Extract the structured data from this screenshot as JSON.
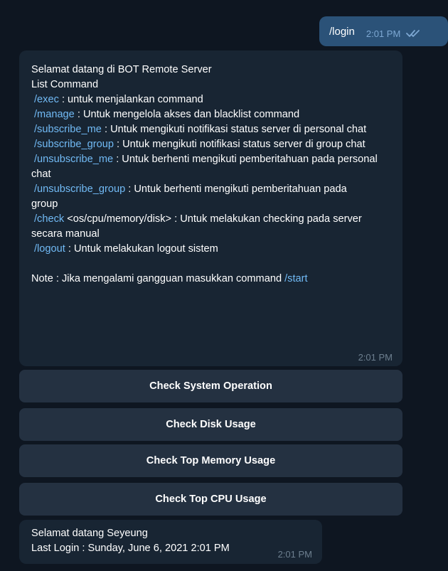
{
  "outgoing": {
    "text": "/login",
    "time": "2:01 PM",
    "status_icon": "double-check-icon"
  },
  "welcome_message": {
    "greeting": "Selamat datang di BOT Remote Server",
    "list_title": "List Command",
    "commands": [
      {
        "cmd": "/exec",
        "desc": " : untuk menjalankan command"
      },
      {
        "cmd": "/manage",
        "desc": " : Untuk mengelola akses dan blacklist command"
      },
      {
        "cmd": "/subscribe_me",
        "desc": " : Untuk mengikuti notifikasi status server di personal chat"
      },
      {
        "cmd": "/subscribe_group",
        "desc": " : Untuk mengikuti notifikasi status server di group chat"
      },
      {
        "cmd": "/unsubscribe_me",
        "desc": " : Untuk berhenti mengikuti pemberitahuan pada personal chat"
      },
      {
        "cmd": "/unsubscribe_group",
        "desc": " : Untuk berhenti mengikuti pemberitahuan pada group"
      },
      {
        "cmd": "/check",
        "desc": " <os/cpu/memory/disk>  : Untuk melakukan checking pada server secara manual"
      },
      {
        "cmd": "/logout",
        "desc": " : Untuk melakukan logout sistem"
      }
    ],
    "note_prefix": "Note : Jika mengalami gangguan masukkan command ",
    "note_cmd": "/start",
    "time": "2:01 PM"
  },
  "keyboard_buttons": [
    "Check System Operation",
    "Check Disk Usage",
    "Check Top Memory Usage",
    "Check Top CPU Usage"
  ],
  "login_message": {
    "line1": "Selamat datang Seyeung",
    "line2": "Last Login : Sunday, June 6, 2021 2:01 PM",
    "time": "2:01 PM"
  },
  "colors": {
    "background": "#0e1621",
    "outgoing_bubble": "#2b5278",
    "incoming_bubble": "#182533",
    "button": "#243141",
    "command_link": "#71baf5"
  }
}
